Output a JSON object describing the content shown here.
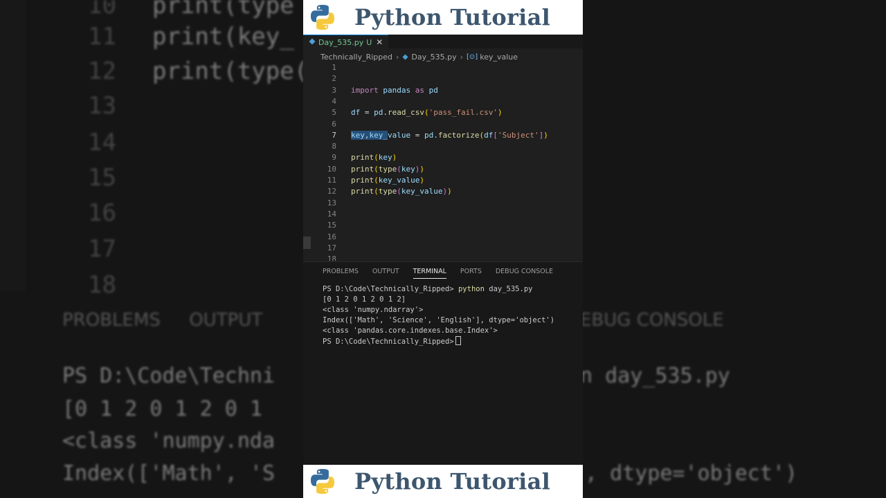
{
  "banner": {
    "title": "Python Tutorial"
  },
  "tab": {
    "filename": "Day_535.py",
    "status": "U",
    "close": "✕"
  },
  "breadcrumb": {
    "folder": "Technically_Ripped",
    "file": "Day_535.py",
    "symbol": "key_value"
  },
  "editor": {
    "lines": [
      {
        "n": "1",
        "code": ""
      },
      {
        "n": "2",
        "code": ""
      },
      {
        "n": "3",
        "code": "import pandas as pd"
      },
      {
        "n": "4",
        "code": ""
      },
      {
        "n": "5",
        "code": "df = pd.read_csv('pass_fail.csv')"
      },
      {
        "n": "6",
        "code": ""
      },
      {
        "n": "7",
        "code": "key,key_value = pd.factorize(df['Subject'])"
      },
      {
        "n": "8",
        "code": ""
      },
      {
        "n": "9",
        "code": "print(key)"
      },
      {
        "n": "10",
        "code": "print(type(key))"
      },
      {
        "n": "11",
        "code": "print(key_value)"
      },
      {
        "n": "12",
        "code": "print(type(key_value))"
      },
      {
        "n": "13",
        "code": ""
      },
      {
        "n": "14",
        "code": ""
      },
      {
        "n": "15",
        "code": ""
      },
      {
        "n": "16",
        "code": ""
      },
      {
        "n": "17",
        "code": ""
      },
      {
        "n": "18",
        "code": ""
      }
    ]
  },
  "panel": {
    "tabs": [
      "PROBLEMS",
      "OUTPUT",
      "TERMINAL",
      "PORTS",
      "DEBUG CONSOLE"
    ],
    "active_tab": "TERMINAL"
  },
  "terminal": {
    "prompt": "PS D:\\Code\\Technically_Ripped>",
    "command": "python",
    "args": "day_535.py",
    "output": [
      "[0 1 2 0 1 2 0 1 2]",
      "<class 'numpy.ndarray'>",
      "Index(['Math', 'Science', 'English'], dtype='object')",
      "<class 'pandas.core.indexes.base.Index'>"
    ],
    "final_prompt": "PS D:\\Code\\Technically_Ripped>"
  },
  "background": {
    "line_numbers": [
      "10",
      "11",
      "12",
      "13",
      "14",
      "15",
      "16",
      "17",
      "18"
    ],
    "code": [
      "print(type",
      "print(key_",
      "print(type("
    ],
    "tabs_left": "PROBLEMS     OUTPUT",
    "tabs_right": "EBUG CONSOLE",
    "term_left": [
      "PS D:\\Code\\Techni",
      "[0 1 2 0 1 2 0 1",
      "<class 'numpy.nda",
      "Index(['Math', 'S"
    ],
    "term_right": [
      "n day_535.py",
      "",
      "",
      ", dtype='object')"
    ]
  },
  "colors": {
    "accent": "#0078d4",
    "banner_text": "#3d566e",
    "editor_bg": "#1f1f1f",
    "panel_bg": "#181818"
  }
}
